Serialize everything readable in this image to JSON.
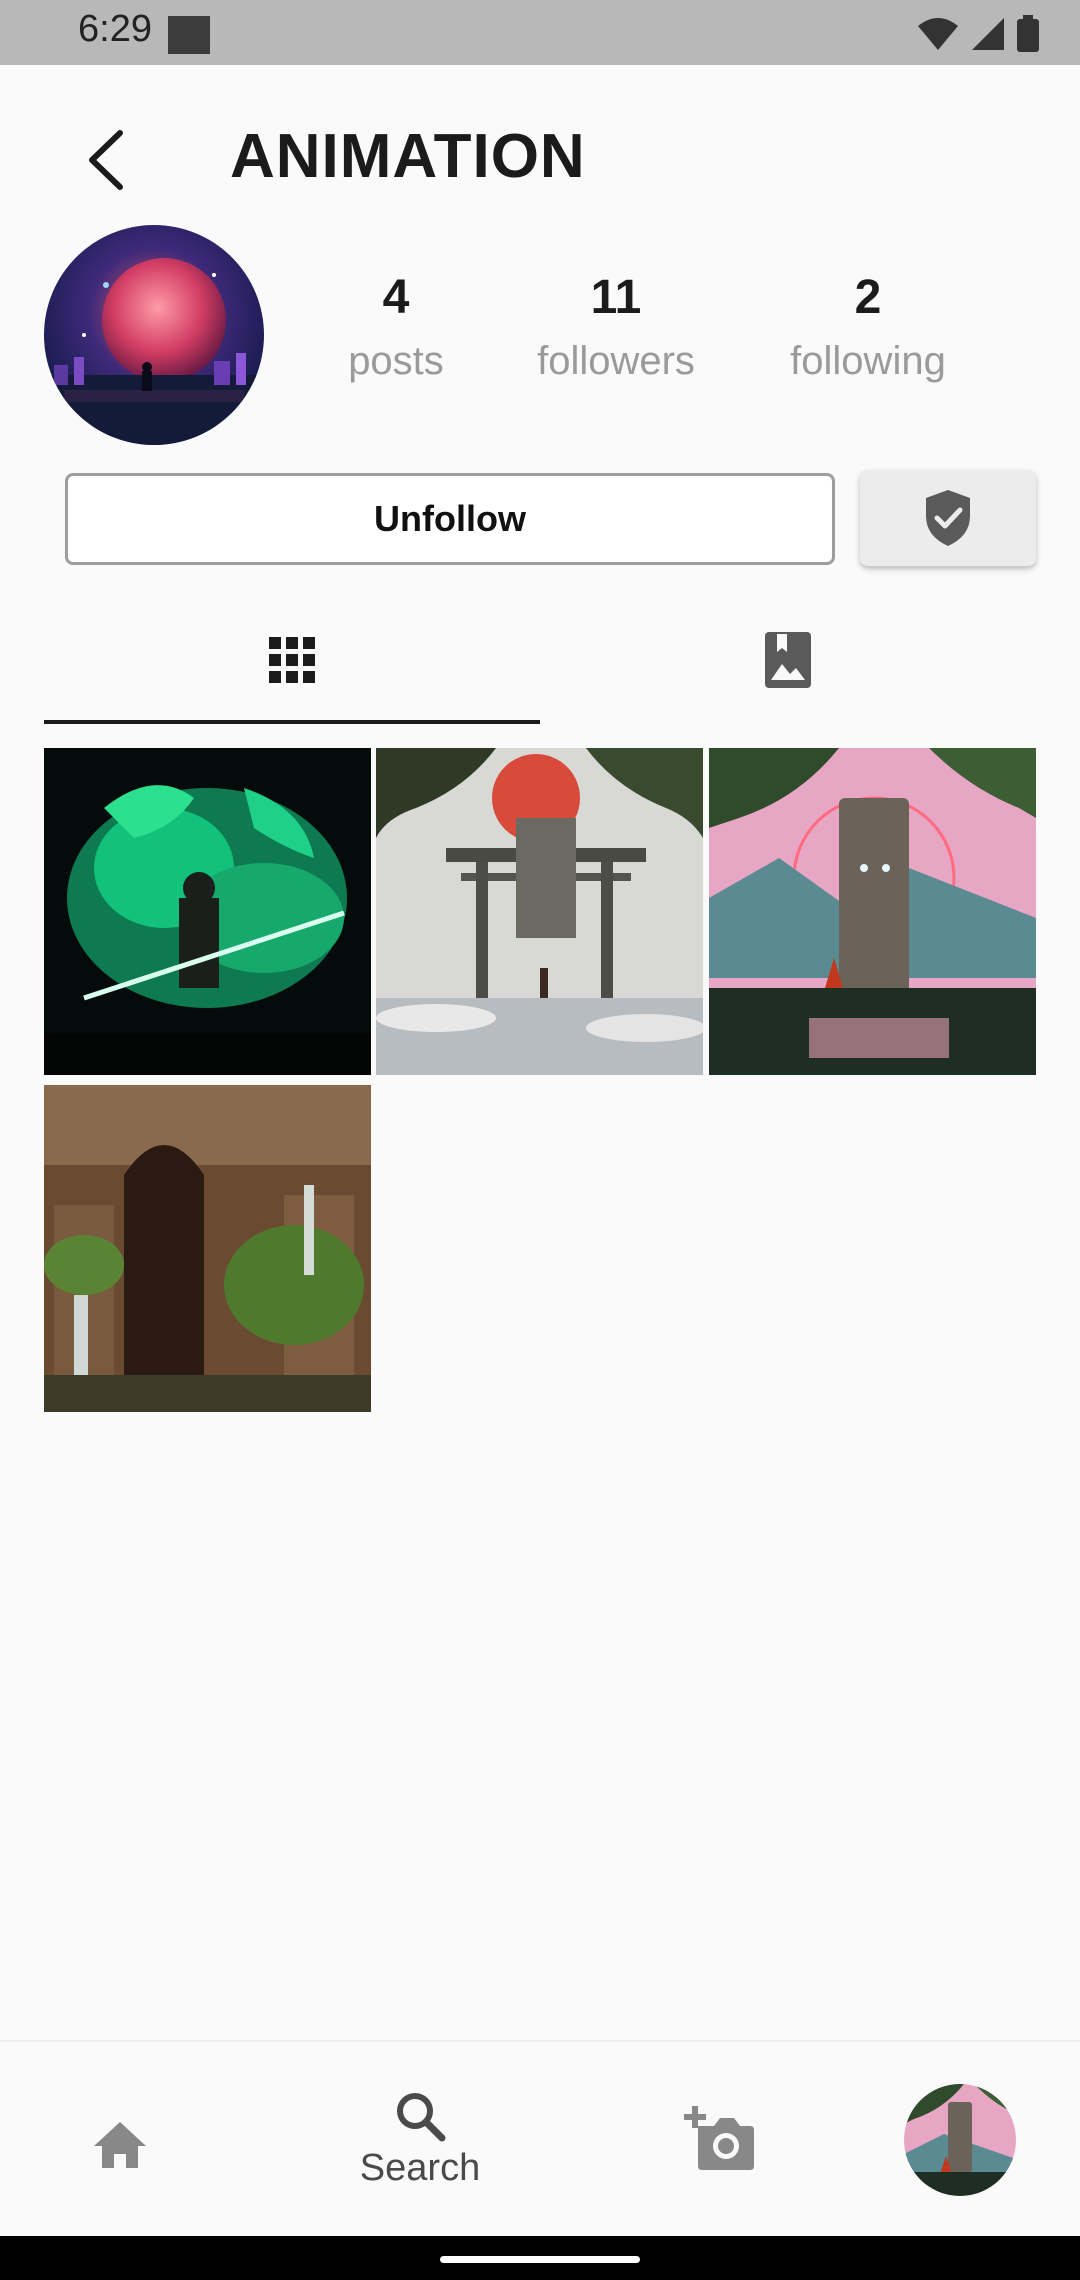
{
  "status_bar": {
    "time": "6:29"
  },
  "header": {
    "title": "ANIMATION"
  },
  "profile": {
    "stats": [
      {
        "count": "4",
        "label": "posts"
      },
      {
        "count": "11",
        "label": "followers"
      },
      {
        "count": "2",
        "label": "following"
      }
    ]
  },
  "actions": {
    "unfollow_label": "Unfollow"
  },
  "bottom_nav": {
    "search_label": "Search"
  },
  "colors": {
    "accent": "#1b1b1b",
    "muted_text": "#9a9a9a",
    "status_bar": "#b8b8b8"
  }
}
